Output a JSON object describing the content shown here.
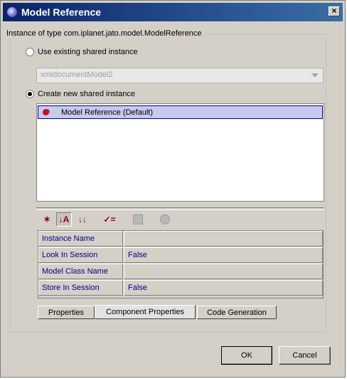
{
  "window": {
    "title": "Model Reference",
    "close_glyph": "×"
  },
  "group": {
    "legend": "Instance of type com.iplanet.jato.model.ModelReference"
  },
  "options": {
    "use_existing_label": "Use existing shared instance",
    "use_existing_selected": false,
    "combo_value": "xmldocumentModel2",
    "create_new_label": "Create new shared instance",
    "create_new_selected": true
  },
  "list": {
    "items": [
      {
        "label": "Model Reference (Default)",
        "selected": true
      }
    ]
  },
  "toolbar": {
    "icons": [
      "unsorted-icon",
      "sort-by-name-icon",
      "sort-by-type-icon",
      "customize-icon",
      "square-icon",
      "circle-icon"
    ],
    "unsorted_glyph": "✶",
    "sort_name_glyph": "↓A",
    "sort_type_glyph": "↓↓",
    "customize_glyph": "✓="
  },
  "properties": {
    "rows": [
      {
        "name": "Instance Name",
        "value": ""
      },
      {
        "name": "Look In Session",
        "value": "False"
      },
      {
        "name": "Model Class Name",
        "value": ""
      },
      {
        "name": "Store In Session",
        "value": "False"
      }
    ]
  },
  "tabs": [
    {
      "label": "Properties",
      "active": false
    },
    {
      "label": "Component Properties",
      "active": true
    },
    {
      "label": "Code Generation",
      "active": false
    }
  ],
  "buttons": {
    "ok_label": "OK",
    "cancel_label": "Cancel"
  }
}
